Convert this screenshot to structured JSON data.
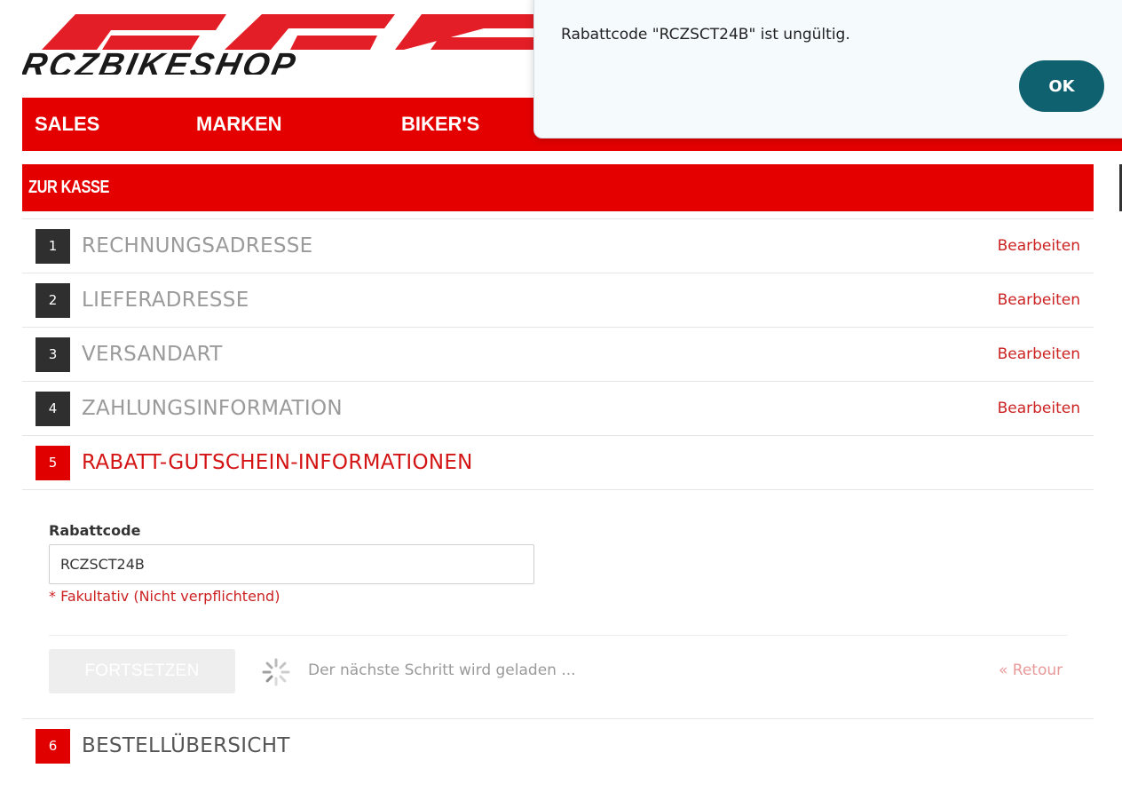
{
  "logo": {
    "text": "RCZBIKESHOP"
  },
  "nav": {
    "items": [
      {
        "label": "SALES"
      },
      {
        "label": "MARKEN"
      },
      {
        "label": "BIKER'S"
      }
    ]
  },
  "checkout": {
    "title": "ZUR KASSE"
  },
  "steps": [
    {
      "number": "1",
      "title": "RECHNUNGSADRESSE",
      "edit": "Bearbeiten"
    },
    {
      "number": "2",
      "title": "LIEFERADRESSE",
      "edit": "Bearbeiten"
    },
    {
      "number": "3",
      "title": "VERSANDART",
      "edit": "Bearbeiten"
    },
    {
      "number": "4",
      "title": "ZAHLUNGSINFORMATION",
      "edit": "Bearbeiten"
    },
    {
      "number": "5",
      "title": "RABATT-GUTSCHEIN-INFORMATIONEN"
    },
    {
      "number": "6",
      "title": "BESTELLÜBERSICHT"
    }
  ],
  "coupon": {
    "label": "Rabattcode",
    "value": "RCZSCT24B",
    "hint": "* Fakultativ (Nicht verpflichtend)",
    "continue_label": "FORTSETZEN",
    "loading_text": "Der nächste Schritt wird geladen ...",
    "back_label": "« Retour"
  },
  "dialog": {
    "message": "Rabattcode \"RCZSCT24B\" ist ungültig.",
    "ok_label": "OK"
  },
  "colors": {
    "brand_red": "#e50000",
    "dialog_button": "#0f6170"
  }
}
